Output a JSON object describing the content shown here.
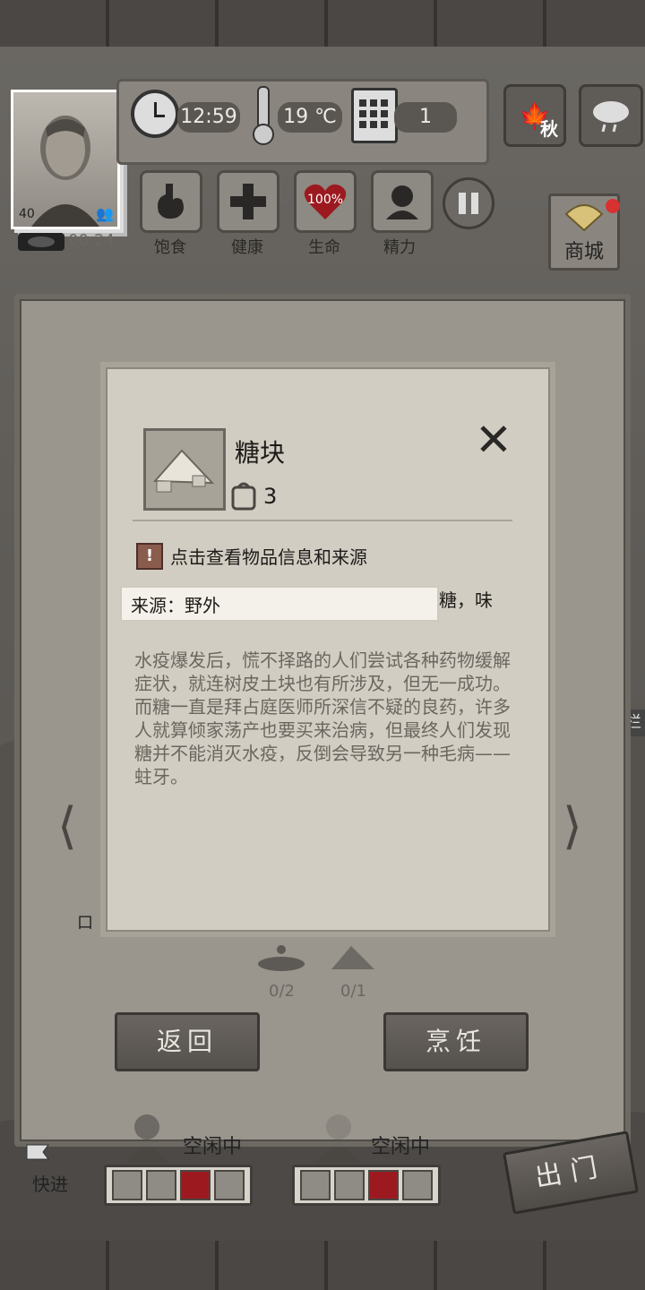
{
  "hud": {
    "time": "12:59",
    "temperature": "19 ℃",
    "day": "1",
    "season": "秋",
    "player_level": "40",
    "timer": "00:24",
    "shop_label": "商城"
  },
  "stats": [
    {
      "label": "饱食",
      "icon": "stomach-icon"
    },
    {
      "label": "健康",
      "icon": "plus-icon"
    },
    {
      "label": "生命",
      "icon": "heart-icon",
      "value": "100%"
    },
    {
      "label": "精力",
      "icon": "person-icon"
    }
  ],
  "background": {
    "side_number": "48",
    "side_char": "栏",
    "bottom_left_char": "口"
  },
  "item_popup": {
    "name": "糖块",
    "count": "3",
    "hint": "点击查看物品信息和来源",
    "source_tooltip": "来源：野外",
    "partial_text_right": "糖，味",
    "description": "水疫爆发后，慌不择路的人们尝试各种药物缓解症状，就连树皮土块也有所涉及，但无一成功。而糖一直是拜占庭医师所深信不疑的良药，许多人就算倾家荡产也要买来治病，但最终人们发现糖并不能消灭水疫，反倒会导致另一种毛病——蛀牙。"
  },
  "ingredients": [
    {
      "icon": "water-icon",
      "count": "0/2"
    },
    {
      "icon": "sugar-icon",
      "count": "0/1"
    }
  ],
  "buttons": {
    "back": "返回",
    "cook": "烹饪",
    "go_out": "出门",
    "fast_forward": "快进"
  },
  "survivors": [
    {
      "status": "空闲中"
    },
    {
      "status": "空闲中"
    }
  ],
  "colors": {
    "heart": "#9c1a1f",
    "notify_dot": "#d93030",
    "hint_badge": "#8a5c4e"
  }
}
